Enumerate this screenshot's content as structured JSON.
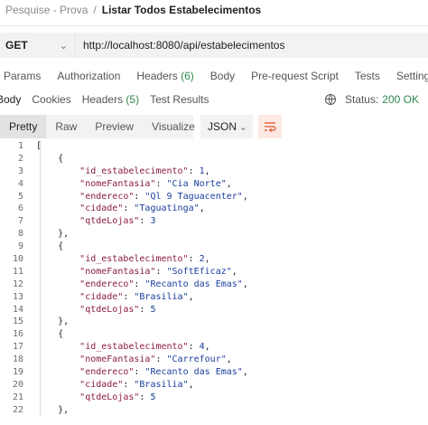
{
  "breadcrumb": {
    "parent": "Pesquise - Prova",
    "separator": "/",
    "current": "Listar Todos Estabelecimentos"
  },
  "request": {
    "method": "GET",
    "url": "http://localhost:8080/api/estabelecimentos"
  },
  "request_tabs": [
    {
      "label": "Params"
    },
    {
      "label": "Authorization"
    },
    {
      "label": "Headers",
      "count": "(6)"
    },
    {
      "label": "Body"
    },
    {
      "label": "Pre-request Script"
    },
    {
      "label": "Tests"
    },
    {
      "label": "Settings"
    }
  ],
  "response_tabs": [
    {
      "label": "Body",
      "active": true
    },
    {
      "label": "Cookies"
    },
    {
      "label": "Headers",
      "count": "(5)"
    },
    {
      "label": "Test Results"
    }
  ],
  "status": {
    "label": "Status:",
    "value": "200 OK"
  },
  "format_options": [
    "Pretty",
    "Raw",
    "Preview",
    "Visualize"
  ],
  "format_active": "Pretty",
  "language": "JSON",
  "code_lines": [
    "[",
    "    {",
    "        \"id_estabelecimento\": 1,",
    "        \"nomeFantasia\": \"Cia Norte\",",
    "        \"endereco\": \"Ql 9 Taguacenter\",",
    "        \"cidade\": \"Taguatinga\",",
    "        \"qtdeLojas\": 3",
    "    },",
    "    {",
    "        \"id_estabelecimento\": 2,",
    "        \"nomeFantasia\": \"SoftEficaz\",",
    "        \"endereco\": \"Recanto das Emas\",",
    "        \"cidade\": \"Brasilia\",",
    "        \"qtdeLojas\": 5",
    "    },",
    "    {",
    "        \"id_estabelecimento\": 4,",
    "        \"nomeFantasia\": \"Carrefour\",",
    "        \"endereco\": \"Recanto das Emas\",",
    "        \"cidade\": \"Brasilia\",",
    "        \"qtdeLojas\": 5",
    "    },"
  ]
}
